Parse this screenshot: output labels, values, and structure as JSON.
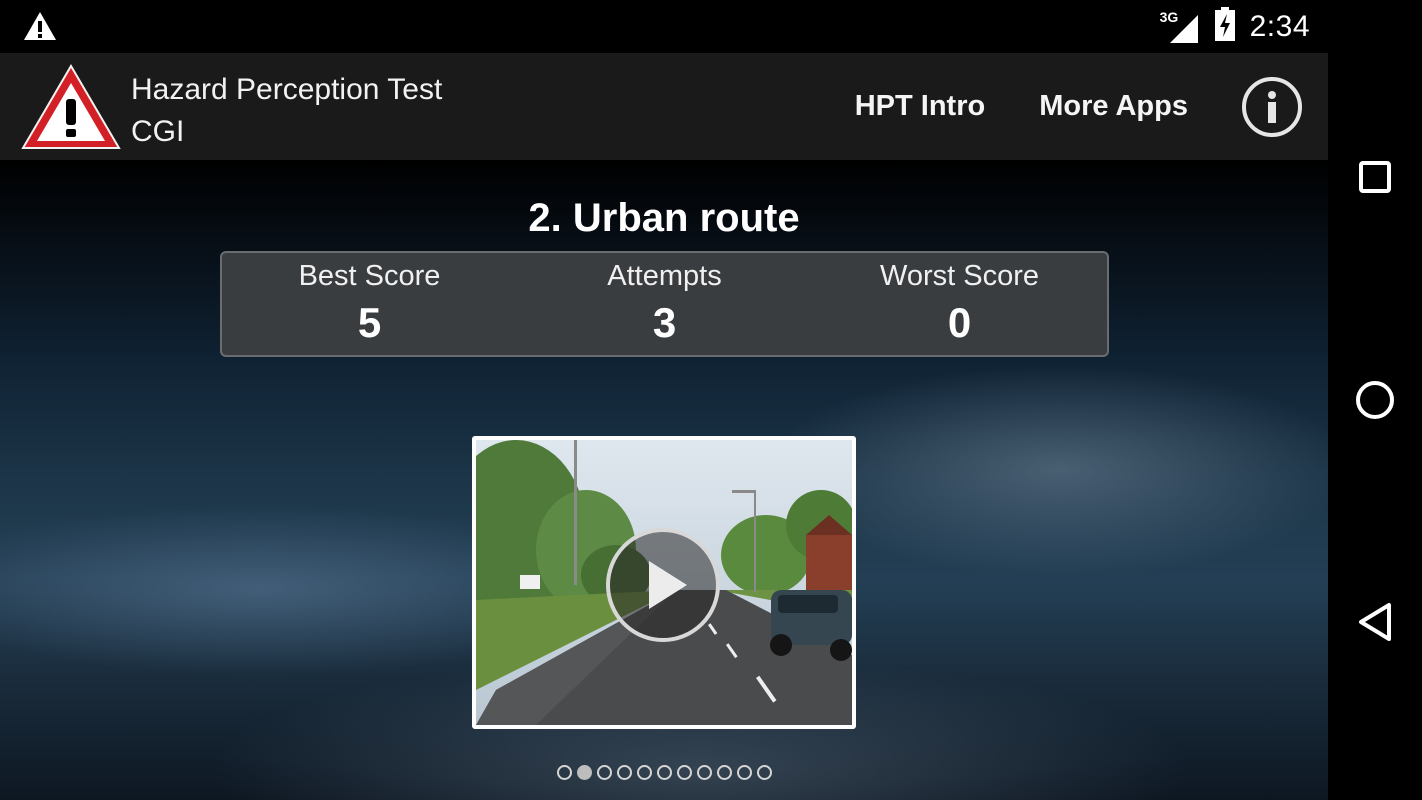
{
  "status_bar": {
    "network": "3G",
    "time": "2:34",
    "icons": [
      "warning-icon",
      "signal-3g-icon",
      "battery-charging-icon"
    ]
  },
  "app_bar": {
    "title_line1": "Hazard Perception Test",
    "title_line2": "CGI",
    "actions": [
      "HPT Intro",
      "More Apps"
    ],
    "info_icon": "info-icon",
    "logo_icon": "hazard-warning-triangle-icon"
  },
  "route": {
    "title": "2. Urban route",
    "scores": [
      {
        "label": "Best Score",
        "value": "5"
      },
      {
        "label": "Attempts",
        "value": "3"
      },
      {
        "label": "Worst Score",
        "value": "0"
      }
    ]
  },
  "video": {
    "play_icon": "play-icon"
  },
  "pager": {
    "count": 11,
    "active_index": 1
  },
  "nav_bar": {
    "icons": [
      "recents-square-icon",
      "home-circle-icon",
      "back-triangle-icon"
    ]
  },
  "colors": {
    "app_bar_bg": "#1a1a1a",
    "logo_red": "#d32026",
    "score_box_bg": "#3a3d40"
  }
}
